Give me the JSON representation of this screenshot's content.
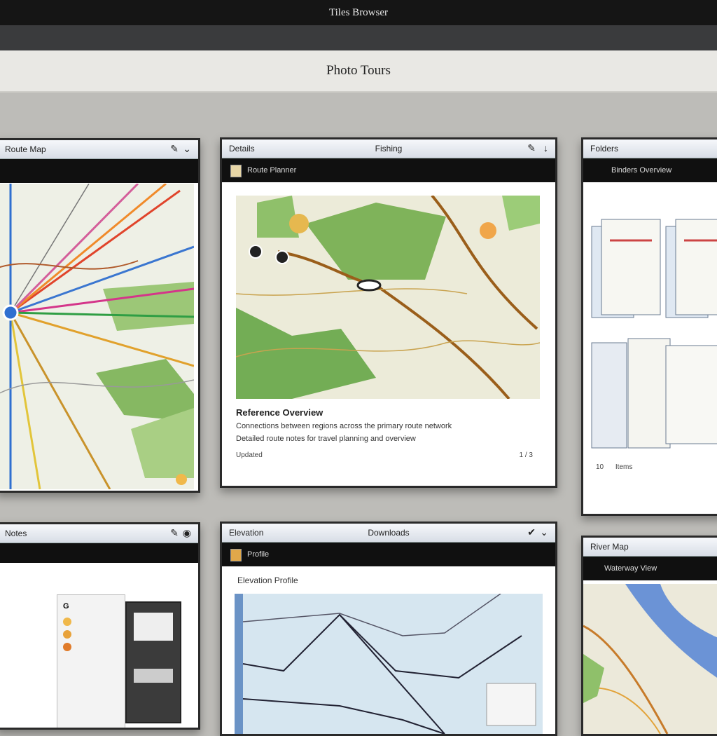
{
  "window": {
    "title": "Tiles Browser"
  },
  "toolbar": {
    "title": "Photo Tours"
  },
  "tiles": [
    {
      "title": "Route Map",
      "subtitle": ""
    },
    {
      "title": "Details",
      "center": "Fishing",
      "subtitle": "Route Planner",
      "caption": {
        "heading": "Reference Overview",
        "line1": "Connections between regions across the primary route network",
        "line2": "Detailed route notes for travel planning and overview",
        "footer": "Updated",
        "pager": "1 / 3"
      }
    },
    {
      "title": "Folders",
      "subtitle": "Binders Overview",
      "footer_left": "10",
      "footer_right": "Items"
    },
    {
      "title": "Notes"
    },
    {
      "title": "Elevation",
      "center": "Downloads",
      "subtitle": "Profile",
      "chart_title": "Elevation Profile"
    },
    {
      "title": "River Map",
      "subtitle": "Waterway View"
    }
  ],
  "icons": {
    "ui": [
      "close-icon",
      "pin-icon",
      "doc-icon",
      "chevron-icon"
    ]
  },
  "colors": {
    "accent": "#c77b2a",
    "map_green": "#7fb35a",
    "water": "#6b93d6"
  }
}
